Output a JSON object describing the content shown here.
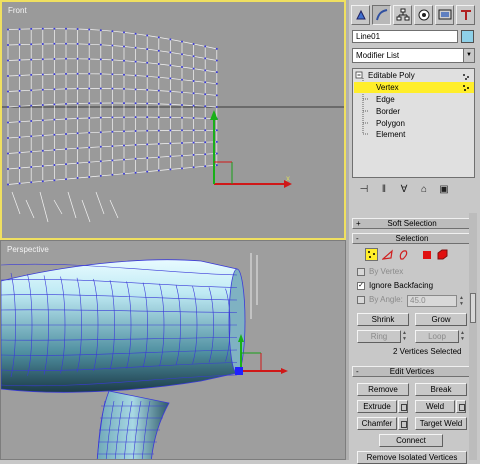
{
  "viewports": {
    "front_label": "Front",
    "perspective_label": "Perspective",
    "axis_x_label": "x"
  },
  "command_panel": {
    "tabs": [
      "create-icon",
      "modify-icon",
      "hierarchy-icon",
      "motion-icon",
      "display-icon",
      "utilities-icon"
    ],
    "object_name": "Line01",
    "object_color": "#8ed0e8",
    "modifier_list_label": "Modifier List",
    "stack": {
      "root": "Editable Poly",
      "items": [
        "Vertex",
        "Edge",
        "Border",
        "Polygon",
        "Element"
      ],
      "selected": "Vertex"
    }
  },
  "rollouts": {
    "soft_selection": {
      "title": "Soft Selection",
      "state": "+"
    },
    "selection": {
      "title": "Selection",
      "state": "-",
      "by_vertex_label": "By Vertex",
      "ignore_backfacing_label": "Ignore Backfacing",
      "ignore_backfacing_checked": "✓",
      "by_angle_label": "By Angle:",
      "by_angle_value": "45.0",
      "shrink": "Shrink",
      "grow": "Grow",
      "ring": "Ring",
      "loop": "Loop",
      "status": "2 Vertices Selected"
    },
    "edit_vertices": {
      "title": "Edit Vertices",
      "state": "-",
      "remove": "Remove",
      "break": "Break",
      "extrude": "Extrude",
      "weld": "Weld",
      "chamfer": "Chamfer",
      "target_weld": "Target Weld",
      "connect": "Connect",
      "remove_isolated": "Remove Isolated Vertices"
    }
  },
  "colors": {
    "active_viewport_border": "#f0e060",
    "selected_stack_item": "#ffee2a",
    "mesh_wire": "#3a3ad8",
    "mesh_surface": "#9ad8e8"
  }
}
